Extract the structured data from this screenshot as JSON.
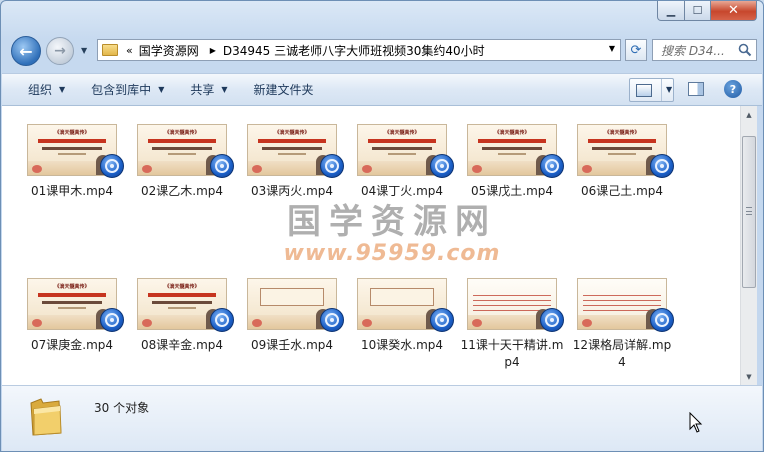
{
  "window": {
    "caption_buttons": {
      "minimize_glyph": "▁",
      "maximize_glyph": "☐",
      "close_glyph": "✕"
    }
  },
  "nav": {
    "back_glyph": "←",
    "forward_glyph": "→",
    "recent_glyph": "▼"
  },
  "address": {
    "overflow": "«",
    "segments": [
      "国学资源网",
      "D34945 三诚老师八字大师班视频30集约40小时"
    ],
    "separator": "▶",
    "dropdown_glyph": "▼"
  },
  "refresh_glyph": "⟳",
  "search": {
    "placeholder": "搜索 D34..."
  },
  "toolbar": {
    "organize": "组织",
    "include_library": "包含到库中",
    "share": "共享",
    "new_folder": "新建文件夹",
    "arrow": "▼",
    "view_drop": "▼",
    "help": "?"
  },
  "files": [
    {
      "name": "01课甲木.mp4",
      "thumb_title": "《滴天髓真传》",
      "kind": "slide"
    },
    {
      "name": "02课乙木.mp4",
      "thumb_title": "《滴天髓真传》",
      "kind": "slide"
    },
    {
      "name": "03课丙火.mp4",
      "thumb_title": "《滴天髓真传》",
      "kind": "slide"
    },
    {
      "name": "04课丁火.mp4",
      "thumb_title": "《滴天髓真传》",
      "kind": "slide"
    },
    {
      "name": "05课戊土.mp4",
      "thumb_title": "《滴天髓真传》",
      "kind": "slide"
    },
    {
      "name": "06课己土.mp4",
      "thumb_title": "《滴天髓真传》",
      "kind": "slide"
    },
    {
      "name": "07课庚金.mp4",
      "thumb_title": "《滴天髓真传》",
      "kind": "slide"
    },
    {
      "name": "08课辛金.mp4",
      "thumb_title": "《滴天髓真传》",
      "kind": "slide"
    },
    {
      "name": "09课壬水.mp4",
      "thumb_title": "",
      "kind": "box"
    },
    {
      "name": "10课癸水.mp4",
      "thumb_title": "",
      "kind": "box"
    },
    {
      "name": "11课十天干精讲.mp4",
      "thumb_title": "",
      "kind": "doc"
    },
    {
      "name": "12课格局详解.mp4",
      "thumb_title": "",
      "kind": "doc"
    }
  ],
  "watermark": {
    "title": "国学资源网",
    "url": "www.95959.com"
  },
  "scrollbar": {
    "up_glyph": "▲",
    "down_glyph": "▼"
  },
  "details": {
    "count": "30 个对象"
  }
}
